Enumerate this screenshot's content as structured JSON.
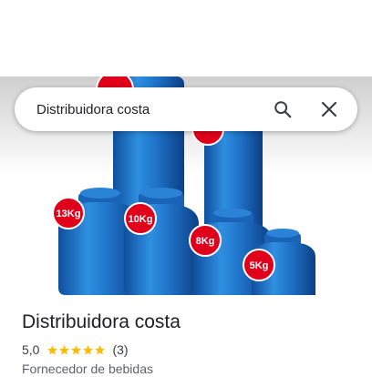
{
  "search": {
    "value": "Distribuidora costa"
  },
  "hero": {
    "badges": [
      "13Kg",
      "10Kg",
      "8Kg",
      "5Kg"
    ],
    "badge_color": "#e0001b",
    "cylinder_color": "#1f73c9"
  },
  "place": {
    "name": "Distribuidora costa",
    "rating": "5,0",
    "stars": 5,
    "review_count": "(3)",
    "category": "Fornecedor de bebidas",
    "star_color": "#fbbc04"
  },
  "icons": {
    "search": "search-icon",
    "close": "close-icon"
  }
}
